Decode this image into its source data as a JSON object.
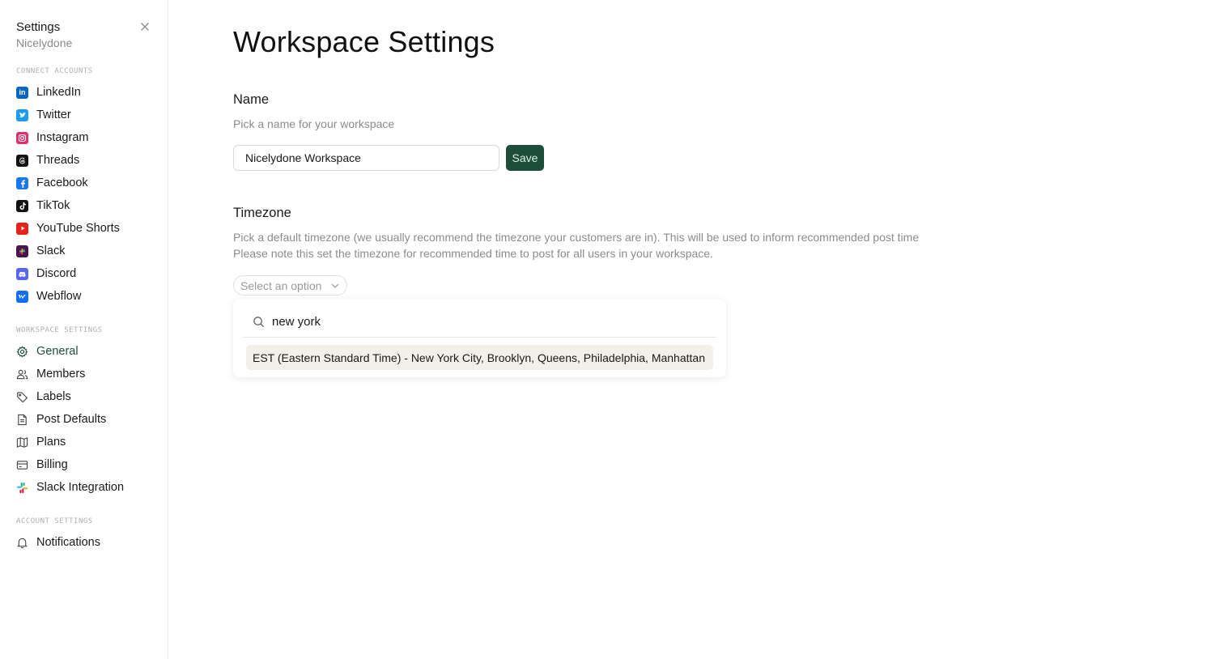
{
  "sidebar": {
    "title": "Settings",
    "subtitle": "Nicelydone",
    "connect_section": "CONNECT ACCOUNTS",
    "accounts": [
      {
        "label": "LinkedIn",
        "icon": "linkedin-icon",
        "color": "#0a66c2"
      },
      {
        "label": "Twitter",
        "icon": "twitter-icon",
        "color": "#1d9bf0"
      },
      {
        "label": "Instagram",
        "icon": "instagram-icon",
        "color": "#e1306c"
      },
      {
        "label": "Threads",
        "icon": "threads-icon",
        "color": "#111111"
      },
      {
        "label": "Facebook",
        "icon": "facebook-icon",
        "color": "#1877f2"
      },
      {
        "label": "TikTok",
        "icon": "tiktok-icon",
        "color": "#111111"
      },
      {
        "label": "YouTube Shorts",
        "icon": "youtube-shorts-icon",
        "color": "#e62117"
      },
      {
        "label": "Slack",
        "icon": "slack-icon",
        "color": "#4a154b"
      },
      {
        "label": "Discord",
        "icon": "discord-icon",
        "color": "#5865f2"
      },
      {
        "label": "Webflow",
        "icon": "webflow-icon",
        "color": "#146ef5"
      }
    ],
    "workspace_section": "WORKSPACE SETTINGS",
    "workspace_items": [
      {
        "label": "General",
        "icon": "gear-icon",
        "active": true
      },
      {
        "label": "Members",
        "icon": "users-icon"
      },
      {
        "label": "Labels",
        "icon": "tag-icon"
      },
      {
        "label": "Post Defaults",
        "icon": "document-icon"
      },
      {
        "label": "Plans",
        "icon": "map-icon"
      },
      {
        "label": "Billing",
        "icon": "credit-card-icon"
      },
      {
        "label": "Slack Integration",
        "icon": "slack-color-icon"
      }
    ],
    "account_section": "ACCOUNT SETTINGS",
    "account_items": [
      {
        "label": "Notifications",
        "icon": "bell-icon"
      }
    ]
  },
  "main": {
    "title": "Workspace Settings",
    "name_section": {
      "label": "Name",
      "description": "Pick a name for your workspace",
      "value": "Nicelydone Workspace",
      "save_label": "Save"
    },
    "timezone_section": {
      "label": "Timezone",
      "description_line1": "Pick a default timezone (we usually recommend the timezone your customers are in). This will be used to inform recommended post time",
      "description_line2": "Please note this set the timezone for recommended time to post for all users in your workspace.",
      "select_placeholder": "Select an option",
      "search_value": "new york",
      "options": [
        "EST (Eastern Standard Time) - New York City, Brooklyn, Queens, Philadelphia, Manhattan"
      ]
    }
  },
  "colors": {
    "accent": "#1f4d3c",
    "highlight": "#f3f0ea"
  }
}
